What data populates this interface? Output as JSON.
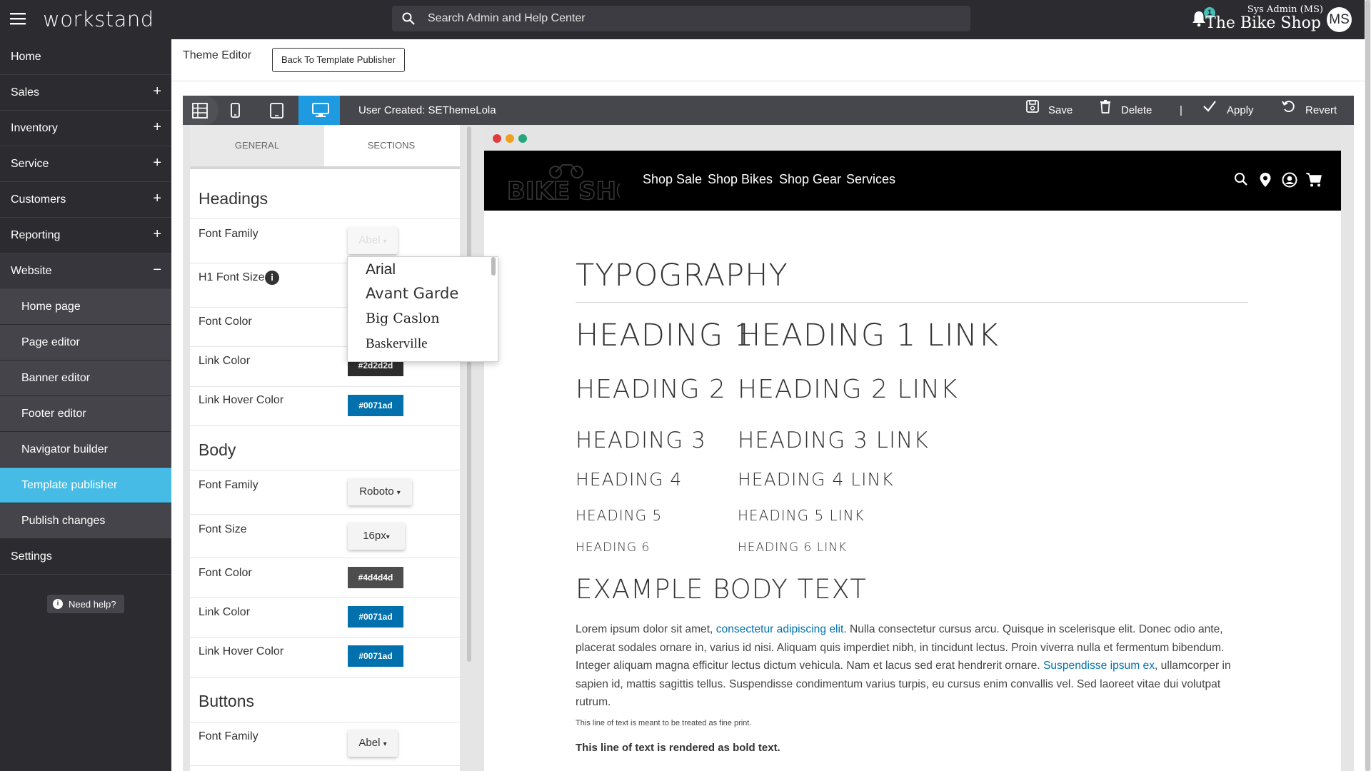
{
  "topbar": {
    "brand": "workstand",
    "search_placeholder": "Search Admin and Help Center",
    "notification_count": "1",
    "user_role": "Sys Admin (MS)",
    "store_name": "The Bike Shop",
    "avatar_initials": "MS"
  },
  "sidebar": {
    "items": [
      {
        "label": "Home",
        "toggle": ""
      },
      {
        "label": "Sales",
        "toggle": "+"
      },
      {
        "label": "Inventory",
        "toggle": "+"
      },
      {
        "label": "Service",
        "toggle": "+"
      },
      {
        "label": "Customers",
        "toggle": "+"
      },
      {
        "label": "Reporting",
        "toggle": "+"
      },
      {
        "label": "Website",
        "toggle": "−"
      }
    ],
    "subitems": [
      {
        "label": "Home page"
      },
      {
        "label": "Page editor"
      },
      {
        "label": "Banner editor"
      },
      {
        "label": "Footer editor"
      },
      {
        "label": "Navigator builder"
      },
      {
        "label": "Template publisher"
      },
      {
        "label": "Publish changes"
      }
    ],
    "settings": "Settings",
    "help": "Need help?"
  },
  "header": {
    "title": "Theme Editor",
    "back_button": "Back To Template Publisher"
  },
  "toolbar": {
    "theme_name": "User Created: SEThemeLola",
    "save": "Save",
    "delete": "Delete",
    "separator": "|",
    "apply": "Apply",
    "revert": "Revert"
  },
  "tabs": {
    "general": "GENERAL",
    "sections": "SECTIONS"
  },
  "headings": {
    "title": "Headings",
    "font_family_label": "Font Family",
    "font_family_value": "Abel",
    "h1_size_label": "H1 Font Size",
    "font_color_label": "Font Color",
    "link_color_label": "Link Color",
    "link_color_value": "#2d2d2d",
    "link_hover_label": "Link Hover Color",
    "link_hover_value": "#0071ad"
  },
  "body_settings": {
    "title": "Body",
    "font_family_label": "Font Family",
    "font_family_value": "Roboto",
    "font_size_label": "Font Size",
    "font_size_value": "16px",
    "font_color_label": "Font Color",
    "font_color_value": "#4d4d4d",
    "link_color_label": "Link Color",
    "link_color_value": "#0071ad",
    "link_hover_label": "Link Hover Color",
    "link_hover_value": "#0071ad"
  },
  "buttons_settings": {
    "title": "Buttons",
    "font_family_label": "Font Family",
    "font_family_value": "Abel"
  },
  "font_options": [
    "Arial",
    "Avant Garde",
    "Big Caslon",
    "Baskerville"
  ],
  "preview": {
    "logo": "BIKE SHOP",
    "nav": [
      "Shop Sale",
      "Shop Bikes",
      "Shop Gear",
      "Services"
    ],
    "typography_title": "TYPOGRAPHY",
    "headings": [
      {
        "h": "HEADING 1",
        "link": "HEADING 1 LINK"
      },
      {
        "h": "HEADING 2",
        "link": "HEADING 2 LINK"
      },
      {
        "h": "HEADING 3",
        "link": "HEADING 3 LINK"
      },
      {
        "h": "HEADING 4",
        "link": "HEADING 4 LINK"
      },
      {
        "h": "HEADING 5",
        "link": "HEADING 5 LINK"
      },
      {
        "h": "HEADING 6",
        "link": "HEADING 6 LINK"
      }
    ],
    "example_title": "EXAMPLE BODY TEXT",
    "body_p1": "Lorem ipsum dolor sit amet, ",
    "body_link1": "consectetur adipiscing elit",
    "body_p2": ". Nulla consectetur cursus arcu. Quisque in scelerisque elit. Donec odio ante, placerat sodales ornare in, varius id nisi. Aliquam quis imperdiet nibh, in tincidunt lectus. Proin viverra nulla et fermentum bibendum. Integer aliquam magna efficitur lectus dictum vehicula. Nam et lacus sed erat hendrerit ornare. ",
    "body_link2": "Suspendisse ipsum ex",
    "body_p3": ", ullamcorper in sapien id, mattis sagittis tellus. Suspendisse condimentum varius turpis, eu cursus enim convallis vel. Sed laoreet vitae dui volutpat rutrum.",
    "fine_print": "This line of text is meant to be treated as fine print.",
    "bold_text": "This line of text is rendered as bold text."
  },
  "colors": {
    "accent": "#1e9be0",
    "sidebar_active": "#45bbe6",
    "link": "#0071ad",
    "dark": "#2b2b30"
  }
}
